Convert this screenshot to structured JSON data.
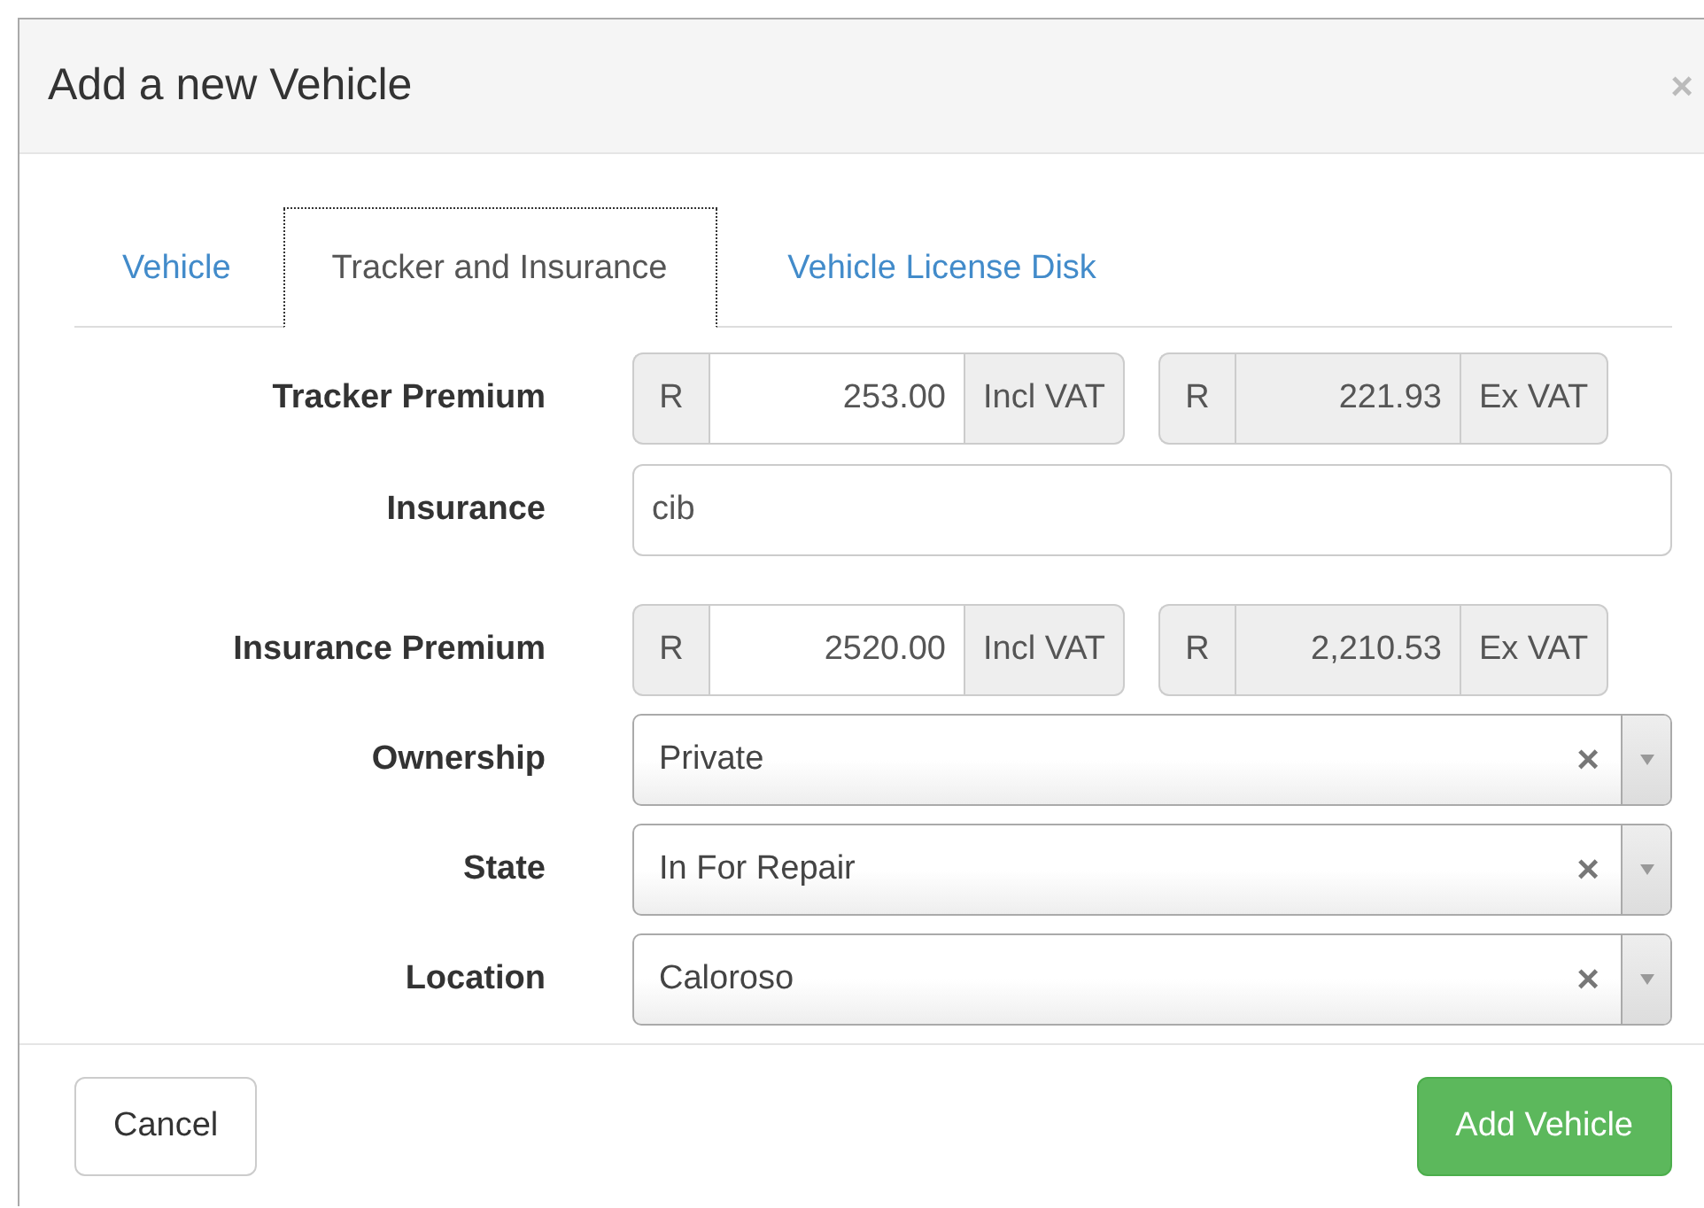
{
  "dialog": {
    "title": "Add a new Vehicle",
    "close": "×"
  },
  "tabs": [
    {
      "label": "Vehicle",
      "selected": false
    },
    {
      "label": "Tracker and Insurance",
      "selected": true
    },
    {
      "label": "Vehicle License Disk",
      "selected": false
    }
  ],
  "fields": [
    {
      "kind": "price",
      "label": "Tracker Premium",
      "groups": [
        {
          "prefix": "R",
          "value": "253.00",
          "suffix": "Incl VAT",
          "readonly": false
        },
        {
          "prefix": "R",
          "value": "221.93",
          "suffix": "Ex VAT",
          "readonly": true
        }
      ]
    },
    {
      "kind": "text",
      "label": "Insurance",
      "value": "cib"
    },
    {
      "kind": "price",
      "label": "Insurance Premium",
      "groups": [
        {
          "prefix": "R",
          "value": "2520.00",
          "suffix": "Incl VAT",
          "readonly": false
        },
        {
          "prefix": "R",
          "value": "2,210.53",
          "suffix": "Ex VAT",
          "readonly": true
        }
      ]
    },
    {
      "kind": "select",
      "label": "Ownership",
      "value": "Private",
      "clear": "×"
    },
    {
      "kind": "select",
      "label": "State",
      "value": "In For Repair",
      "clear": "×"
    },
    {
      "kind": "select",
      "label": "Location",
      "value": "Caloroso",
      "clear": "×"
    }
  ],
  "buttons": [
    {
      "label": "Cancel",
      "kind": "default"
    },
    {
      "label": "Add Vehicle",
      "kind": "primary"
    }
  ]
}
